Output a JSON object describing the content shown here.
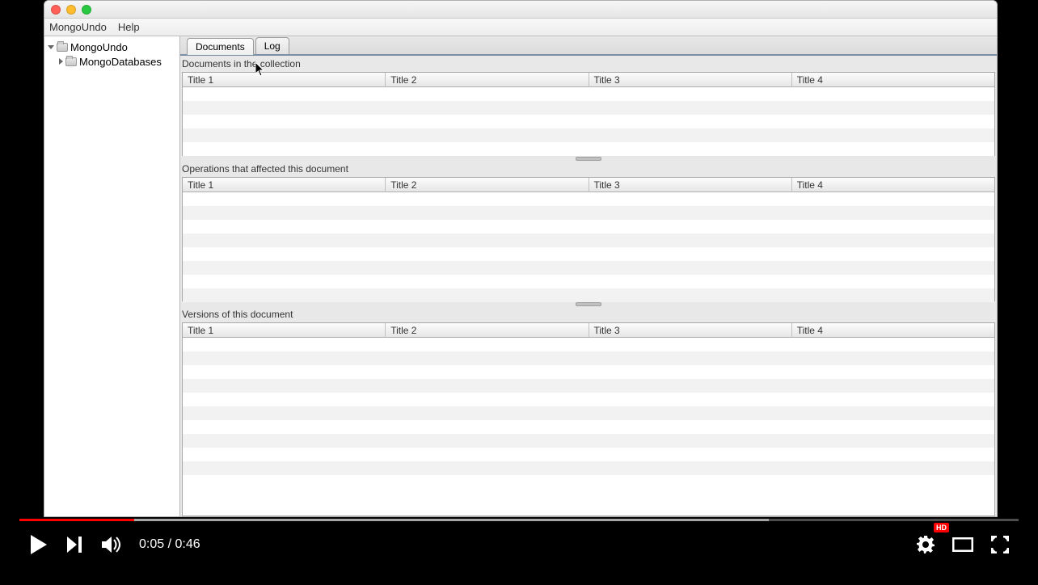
{
  "menubar": {
    "app": "MongoUndo",
    "help": "Help"
  },
  "sidebar": {
    "root": "MongoUndo",
    "child": "MongoDatabases"
  },
  "tabs": {
    "documents": "Documents",
    "log": "Log"
  },
  "sections": {
    "documents_label": "Documents in the collection",
    "operations_label": "Operations that affected this document",
    "versions_label": "Versions of this document"
  },
  "columns": {
    "c1": "Title 1",
    "c2": "Title 2",
    "c3": "Title 3",
    "c4": "Title 4"
  },
  "player": {
    "current": "0:05",
    "sep": " / ",
    "total": "0:46",
    "hd": "HD",
    "played_pct": 11.5,
    "loaded_pct": 75
  }
}
